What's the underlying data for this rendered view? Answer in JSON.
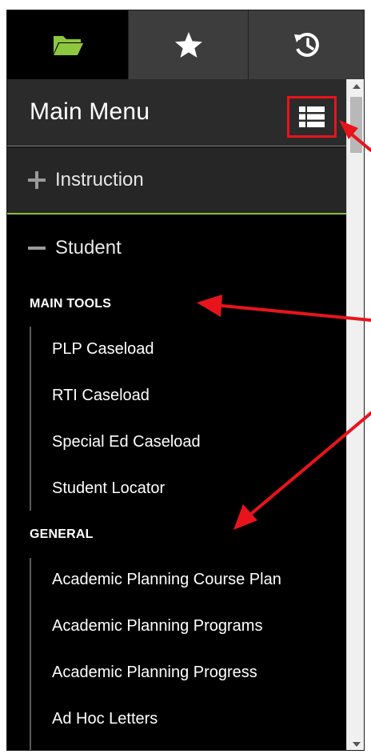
{
  "tabs": [
    {
      "name": "folder-icon",
      "color": "#8dc63f",
      "active": true
    },
    {
      "name": "star-icon",
      "color": "#ffffff",
      "active": false
    },
    {
      "name": "history-icon",
      "color": "#ffffff",
      "active": false
    }
  ],
  "header": {
    "title": "Main Menu",
    "layout_button_icon": "list-view-icon"
  },
  "categories": {
    "instruction": {
      "label": "Instruction",
      "state": "collapsed"
    },
    "student": {
      "label": "Student",
      "state": "expanded"
    }
  },
  "sections": {
    "main_tools": {
      "title": "MAIN TOOLS",
      "items": [
        "PLP Caseload",
        "RTI Caseload",
        "Special Ed Caseload",
        "Student Locator"
      ]
    },
    "general": {
      "title": "GENERAL",
      "items": [
        "Academic Planning Course Plan",
        "Academic Planning Programs",
        "Academic Planning Progress",
        "Ad Hoc Letters"
      ]
    }
  },
  "colors": {
    "accent_green": "#8fbc3f",
    "annotation_red": "#e8141c"
  }
}
